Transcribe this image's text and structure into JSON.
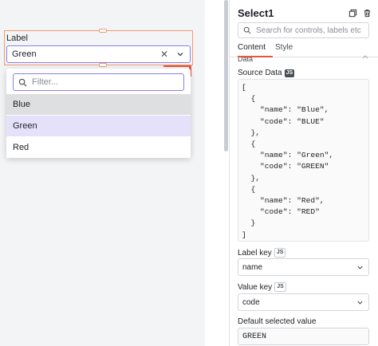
{
  "canvas": {
    "widget_label": "Label",
    "selected_value": "Green",
    "clear_glyph": "✕",
    "filter_placeholder": "Filter...",
    "options": [
      "Blue",
      "Green",
      "Red"
    ],
    "hovered_option": "Blue",
    "selected_option": "Green",
    "colors": {
      "accent": "#8c7ee8",
      "selection_outline": "#f19a71",
      "selected_bg": "#e5e1fb",
      "hover_bg": "#dedfe1"
    }
  },
  "pane": {
    "title": "Select1",
    "search_placeholder": "Search for controls, labels etc",
    "tabs": [
      {
        "label": "Content",
        "active": true
      },
      {
        "label": "Style",
        "active": false
      }
    ],
    "section_partial": "Data",
    "source_data": {
      "label": "Source Data",
      "badge": "JS",
      "code": "[\n  {\n    \"name\": \"Blue\",\n    \"code\": \"BLUE\"\n  },\n  {\n    \"name\": \"Green\",\n    \"code\": \"GREEN\"\n  },\n  {\n    \"name\": \"Red\",\n    \"code\": \"RED\"\n  }\n]"
    },
    "label_key": {
      "label": "Label key",
      "badge": "JS",
      "value": "name"
    },
    "value_key": {
      "label": "Value key",
      "badge": "JS",
      "value": "code"
    },
    "default_selected": {
      "label": "Default selected value",
      "value": "GREEN"
    },
    "colors": {
      "tab_accent": "#e8563a"
    }
  }
}
